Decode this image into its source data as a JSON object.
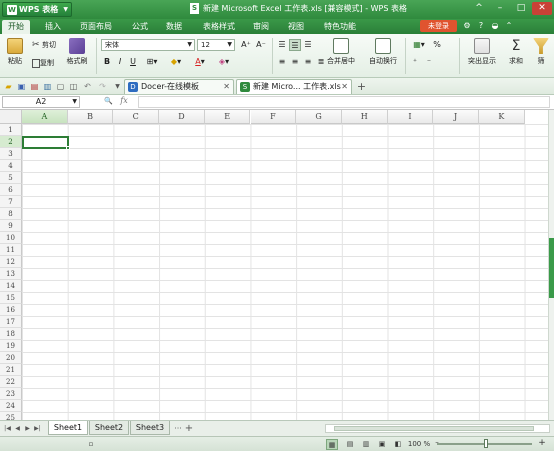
{
  "titlebar": {
    "app_button": "WPS 表格",
    "app_logo": "W",
    "window_title": "新建 Microsoft Excel 工作表.xls [兼容模式] - WPS 表格",
    "doc_icon": "S",
    "controls": [
      "^",
      "–",
      "□",
      "✕"
    ]
  },
  "menubar": {
    "tabs": [
      "开始",
      "插入",
      "页面布局",
      "公式",
      "数据",
      "表格样式",
      "审阅",
      "视图",
      "特色功能"
    ],
    "login_label": "未登录",
    "icons": [
      "⚙",
      "?",
      "◒",
      "⌃"
    ]
  },
  "ribbon": {
    "paste_label": "粘贴",
    "cut_label": "剪切",
    "copy_label": "复制",
    "format_painter_label": "格式刷",
    "font_name": "宋体",
    "font_size": "12",
    "font_grow": "A⁺",
    "font_shrink": "A⁻",
    "bold": "B",
    "italic": "I",
    "underline": "U",
    "merge_label": "合并居中",
    "wrap_label": "自动换行",
    "percent_label": "%",
    "highlight_label": "突出显示",
    "sum_label": "求和",
    "filter_label": "筛",
    "sum_symbol": "Σ"
  },
  "quickbar": {
    "doc_tabs": [
      {
        "label": "Docer-在线模板",
        "icon": "D",
        "close": "✕"
      },
      {
        "label": "新建 Micro... 工作表.xls",
        "icon": "S",
        "close": "✕"
      }
    ],
    "add_tab": "+"
  },
  "formulabar": {
    "namebox_value": "A2",
    "search_icon": "🔍",
    "fx_label": "fx",
    "formula_value": ""
  },
  "grid": {
    "columns": [
      "A",
      "B",
      "C",
      "D",
      "E",
      "F",
      "G",
      "H",
      "I",
      "J",
      "K"
    ],
    "rows": [
      "1",
      "2",
      "3",
      "4",
      "5",
      "6",
      "7",
      "8",
      "9",
      "10",
      "11",
      "12",
      "13",
      "14",
      "15",
      "16",
      "17",
      "18",
      "19",
      "20",
      "21",
      "22",
      "23",
      "24",
      "25"
    ],
    "selected_cell": "A2"
  },
  "sheets": {
    "tabs": [
      "Sheet1",
      "Sheet2",
      "Sheet3"
    ],
    "active": "Sheet1",
    "more": "···",
    "add": "+"
  },
  "statusbar": {
    "zoom": "100 %",
    "zoom_out": "–",
    "zoom_in": "+"
  },
  "colors": {
    "accent": "#2f8a3d",
    "login": "#e0542f",
    "selection": "#2d7d35"
  }
}
